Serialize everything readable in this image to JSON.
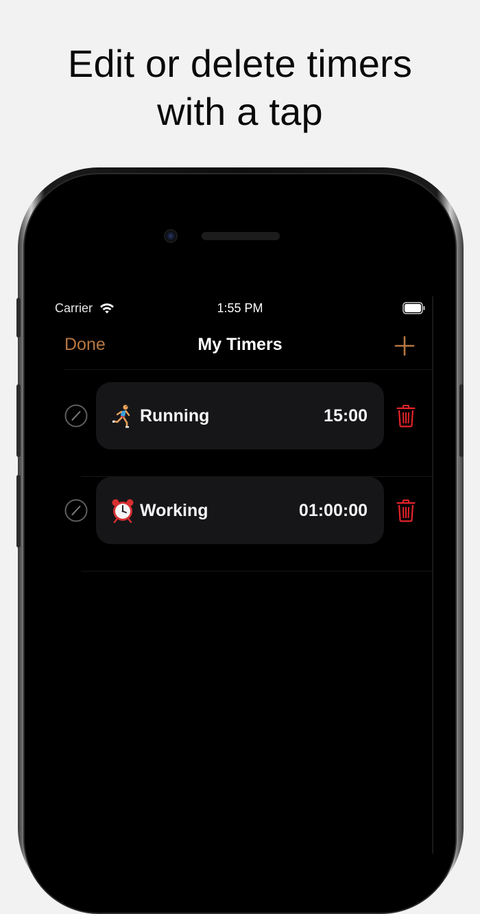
{
  "headline": {
    "line1": "Edit or delete timers",
    "line2": "with a tap"
  },
  "status_bar": {
    "carrier": "Carrier",
    "time": "1:55 PM"
  },
  "nav": {
    "done_label": "Done",
    "title": "My Timers",
    "add_icon": "plus-icon"
  },
  "timers": [
    {
      "icon": "running-person-emoji",
      "name": "Running",
      "duration": "15:00"
    },
    {
      "icon": "alarm-clock-emoji",
      "name": "Working",
      "duration": "01:00:00"
    }
  ],
  "colors": {
    "accent": "#b77742",
    "delete": "#e5242a",
    "card_bg": "#161619",
    "screen_bg": "#000000",
    "page_bg": "#f2f2f2"
  }
}
